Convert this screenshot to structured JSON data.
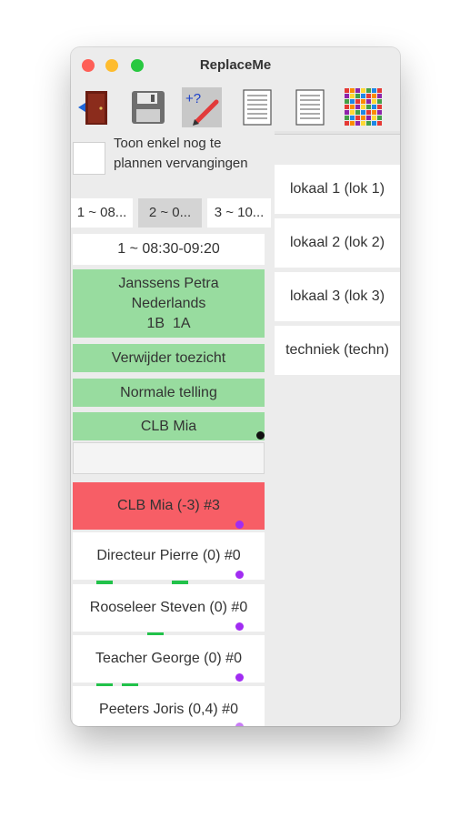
{
  "window": {
    "title": "ReplaceMe"
  },
  "toolbar": {
    "tools": [
      "exit-door-icon",
      "save-floppy-icon",
      "add-question-pencil-icon",
      "document-icon",
      "document-icon",
      "color-grid-icon"
    ]
  },
  "filter": {
    "label": "Toon enkel nog te plannen vervangingen"
  },
  "slots": [
    "1 ~ 08...",
    "2 ~ 0...",
    "3 ~ 10..."
  ],
  "selected_slot": "1 ~ 08:30-09:20",
  "lesson": {
    "teacher": "Janssens Petra",
    "subject": "Nederlands",
    "classes": "1B  1A"
  },
  "actions": {
    "remove": "Verwijder toezicht",
    "count": "Normale telling",
    "assigned": "CLB Mia"
  },
  "teachers": [
    {
      "label": "CLB Mia (-3) #3"
    },
    {
      "label": "Directeur Pierre (0) #0"
    },
    {
      "label": "Rooseleer Steven (0) #0"
    },
    {
      "label": "Teacher George (0) #0"
    },
    {
      "label": "Peeters Joris (0,4) #0"
    }
  ],
  "rooms": [
    "lokaal 1 (lok 1)",
    "lokaal 2 (lok 2)",
    "lokaal 3 (lok 3)",
    "techniek (techn)"
  ],
  "colors": {
    "green_cell": "#98dc9f",
    "red_cell": "#f75e66",
    "purple_dot": "#a12cf2",
    "bar_green": "#21c24a"
  }
}
